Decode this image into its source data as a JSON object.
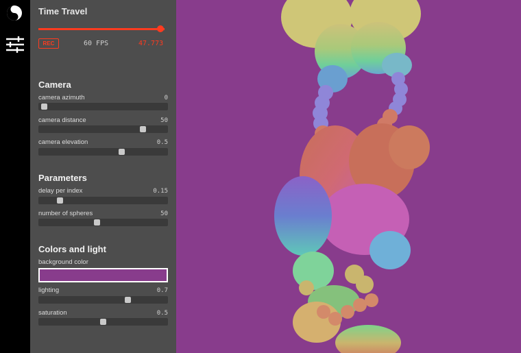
{
  "timeline": {
    "title": "Time Travel",
    "rec_label": "REC",
    "fps": "60 FPS",
    "elapsed": "47.773",
    "progress": 0.97
  },
  "sections": {
    "camera": {
      "title": "Camera",
      "azimuth": {
        "label": "camera azimuth",
        "value": "0",
        "position": 0.02
      },
      "distance": {
        "label": "camera distance",
        "value": "50",
        "position": 0.82
      },
      "elevation": {
        "label": "camera elevation",
        "value": "0.5",
        "position": 0.65
      }
    },
    "parameters": {
      "title": "Parameters",
      "delay": {
        "label": "delay per index",
        "value": "0.15",
        "position": 0.15
      },
      "spheres": {
        "label": "number of spheres",
        "value": "50",
        "position": 0.45
      }
    },
    "colors": {
      "title": "Colors and light",
      "background": {
        "label": "background color",
        "color": "#883c8c"
      },
      "lighting": {
        "label": "lighting",
        "value": "0.7",
        "position": 0.7
      },
      "saturation": {
        "label": "saturation",
        "value": "0.5",
        "position": 0.5
      }
    }
  },
  "icons": {
    "logo": "yin-yang-icon",
    "settings": "sliders-icon"
  },
  "colors": {
    "accent": "#ff3b1f",
    "panel": "#4d4d4d",
    "sidebar": "#000000",
    "scene_background": "#883c8c"
  }
}
